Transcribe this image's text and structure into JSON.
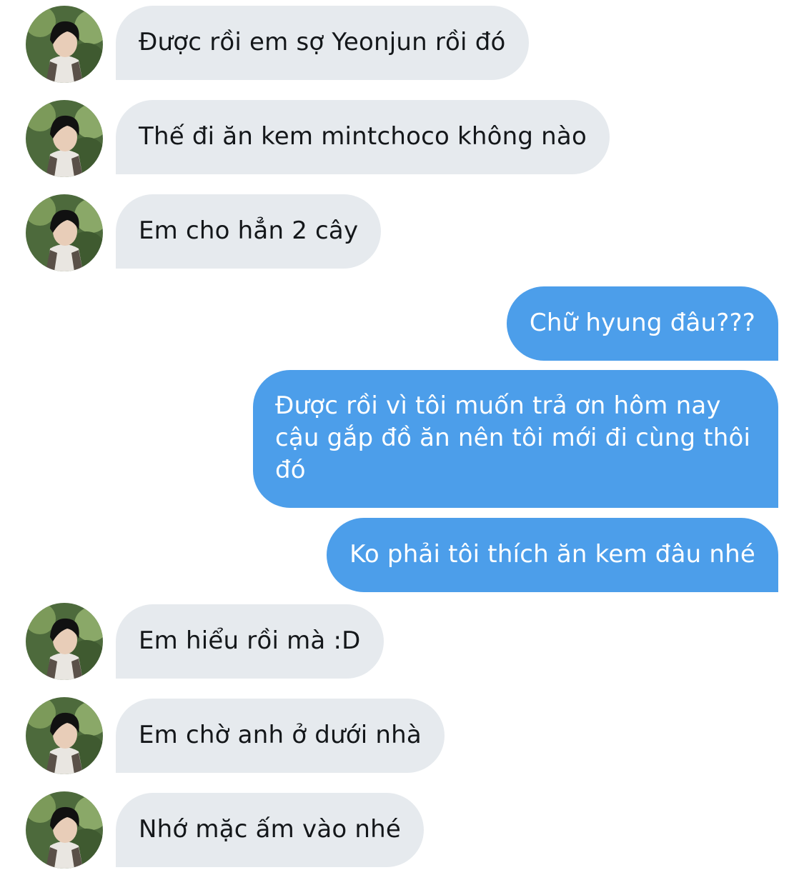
{
  "colors": {
    "incoming_bubble": "#e6eaee",
    "outgoing_bubble": "#4c9eea",
    "incoming_text": "#14171a",
    "outgoing_text": "#ffffff"
  },
  "messages": [
    {
      "direction": "incoming",
      "text": "Được rồi em sợ Yeonjun rồi đó"
    },
    {
      "direction": "incoming",
      "text": "Thế đi ăn kem mintchoco không nào"
    },
    {
      "direction": "incoming",
      "text": "Em cho hẳn 2 cây"
    },
    {
      "direction": "outgoing",
      "text": "Chữ hyung đâu???"
    },
    {
      "direction": "outgoing",
      "text": "Được rồi vì tôi muốn trả ơn hôm nay cậu gắp đồ ăn nên tôi mới đi cùng thôi đó"
    },
    {
      "direction": "outgoing",
      "text": "Ko phải tôi thích ăn kem đâu nhé"
    },
    {
      "direction": "incoming",
      "text": "Em hiểu rồi mà :D"
    },
    {
      "direction": "incoming",
      "text": "Em chờ anh ở dưới nhà"
    },
    {
      "direction": "incoming",
      "text": "Nhớ mặc ấm vào nhé"
    }
  ]
}
